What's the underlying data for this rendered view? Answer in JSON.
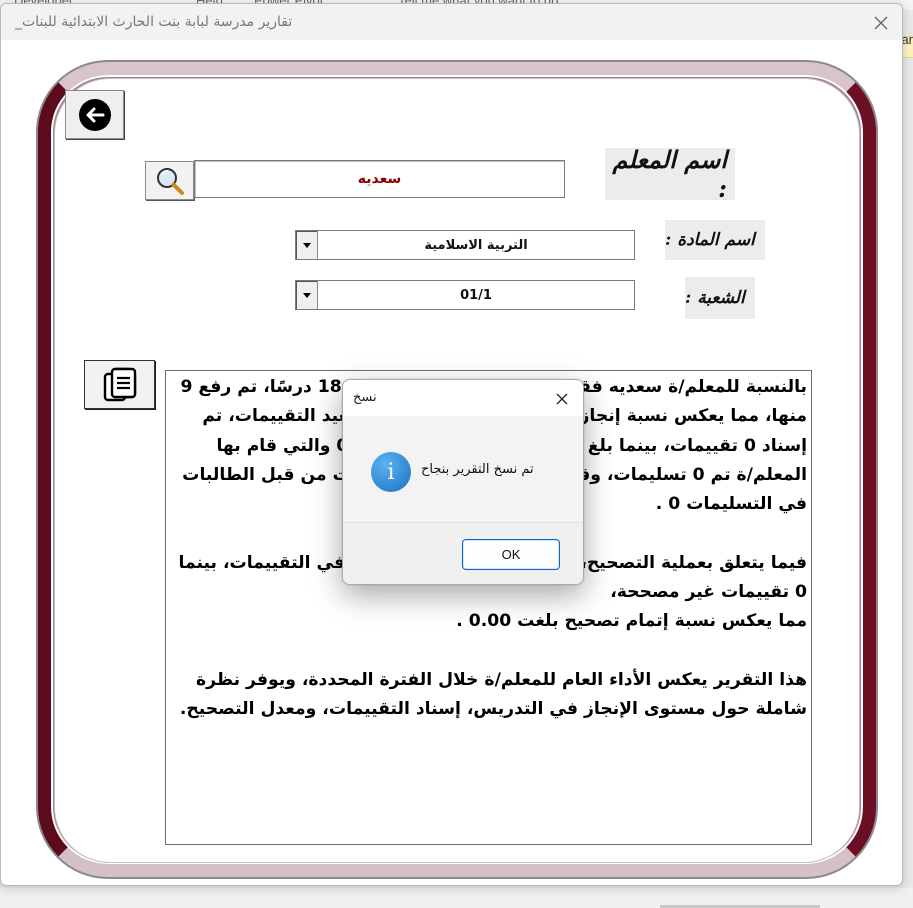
{
  "window": {
    "title": "تقارير مدرسة لبابة بنت الحارث الابتدائية للبنات_",
    "close_symbol": "✕"
  },
  "background": {
    "menu_items": [
      "Developer",
      "Help",
      "Power Pivot",
      "Tell me what you want to do"
    ],
    "right_label": "ar"
  },
  "form": {
    "teacher_label": "اسم المعلم :",
    "teacher_value": "سعديه",
    "subject_label": "اسم المادة :",
    "subject_value": "التربية الاسلامية",
    "section_label": "الشعبة :",
    "section_value": "01/1"
  },
  "report": {
    "paragraphs": [
      "بالنسبة للمعلم/ة سعديه فقد بلغ عدد الدروس المطلوبة 18 درسًا، تم رفع 9 منها، مما يعكس نسبة إنجاز بلغت 50.00 %. أما على صعيد التقييمات، تم إسناد 0 تقييمات، بينما بلغ عدد التقييمات غير المسندة 0 والتي قام بها المعلم/ة تم 0 تسليمات، وقد بلغت نسبة إكمال التقييمات من قبل الطالبات في التسليمات 0 .",
      "فيما يتعلق بعملية التصحيح، تم تصحيح 0 من التسليمات في التقييمات، بينما 0 تقييمات غير مصححة،\nمما يعكس نسبة إتمام تصحيح بلغت 0.00 .",
      "هذا التقرير يعكس الأداء العام للمعلم/ة خلال الفترة المحددة، ويوفر نظرة شاملة حول مستوى الإنجاز في التدريس، إسناد التقييمات، ومعدل التصحيح."
    ]
  },
  "dialog": {
    "title": "نسخ",
    "icon": "info-icon",
    "message": "تم نسخ التقرير بنجاح",
    "ok_label": "OK"
  },
  "colors": {
    "frame_accent": "#8b1530",
    "teacher_name": "#8b0000",
    "dialog_accent": "#0a64c2"
  }
}
